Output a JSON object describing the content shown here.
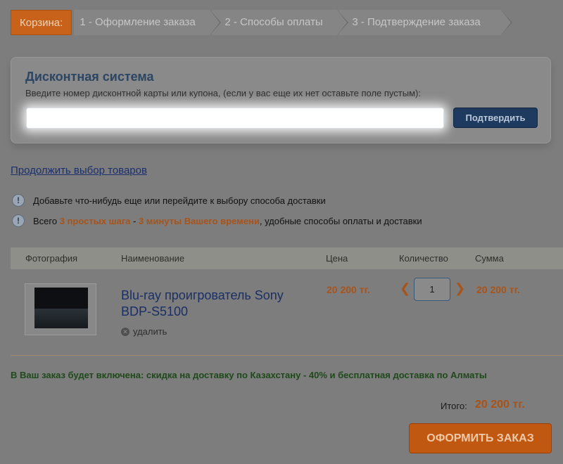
{
  "steps": {
    "cart": "Корзина:",
    "step1": "1 - Оформление заказа",
    "step2": "2 - Способы оплаты",
    "step3": "3 - Подтверждение заказа"
  },
  "discount": {
    "title": "Дисконтная система",
    "hint": "Введите номер дисконтной карты или купона, (если у вас еще их нет оставьте поле пустым):",
    "input_value": "",
    "confirm_label": "Подтвердить"
  },
  "continue_link": "Продолжить выбор товаров",
  "notes": {
    "note1": "Добавьте что-нибудь еще или перейдите к выбору способа доставки",
    "note2_prefix": "Всего ",
    "note2_hl1": "3 простых шага",
    "note2_sep": " - ",
    "note2_hl2": "3 минуты Вашего времени",
    "note2_suffix": ", удобные способы оплаты и доставки",
    "icon": "!"
  },
  "table": {
    "headers": {
      "photo": "Фотография",
      "name": "Наименование",
      "price": "Цена",
      "quantity": "Количество",
      "sum": "Сумма"
    },
    "rows": [
      {
        "name": "Blu-ray проигрователь Sony BDP-S5100",
        "remove_label": "удалить",
        "price": "20 200 тг.",
        "quantity": "1",
        "sum": "20 200 тг."
      }
    ]
  },
  "promo": "В Ваш заказ будет включена: скидка на доставку по Казахстану - 40% и бесплатная доставка по Алматы",
  "total": {
    "label": "Итого:",
    "value": "20 200 тг."
  },
  "checkout_label": "ОФОРМИТЬ ЗАКАЗ",
  "colors": {
    "accent": "#c05812",
    "price": "#a8531a",
    "link": "#1b2f66",
    "promo": "#1e4a1a"
  }
}
